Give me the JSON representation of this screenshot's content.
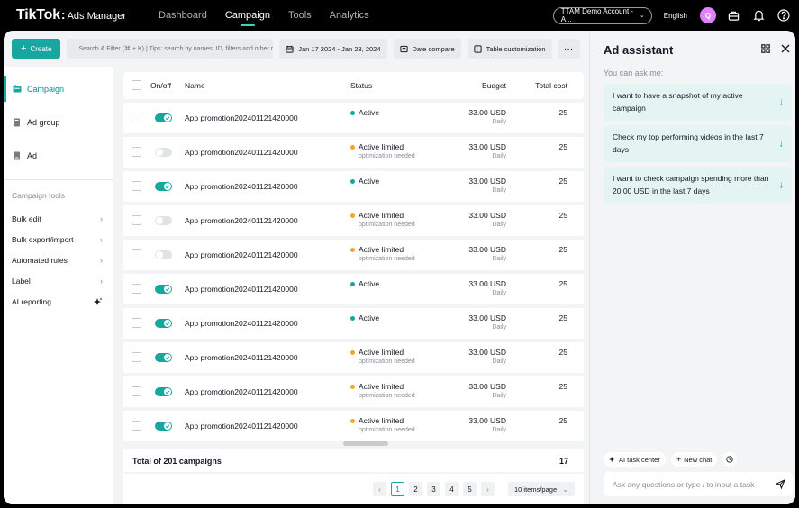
{
  "topbar": {
    "logo": "TikTok",
    "logo_sub": "Ads Manager",
    "nav": [
      "Dashboard",
      "Campaign",
      "Tools",
      "Analytics"
    ],
    "active_nav": "Campaign",
    "account": "TTAM Demo Account - A...",
    "language": "English",
    "avatar_letter": "Q"
  },
  "toolbar": {
    "create_label": "Create",
    "search_placeholder": "Search & Filter (⌘ + K)  |  Tips: search by names, ID, filters and other rela",
    "date_range": "Jan 17 2024  -  Jan 23, 2024",
    "date_compare_label": "Date compare",
    "table_custom_label": "Table customization",
    "more_label": "···"
  },
  "sidebar": {
    "levels": [
      {
        "label": "Campaign",
        "active": true
      },
      {
        "label": "Ad group",
        "active": false
      },
      {
        "label": "Ad",
        "active": false
      }
    ],
    "tools_heading": "Campaign tools",
    "tools": [
      "Bulk edit",
      "Bulk export/import",
      "Automated rules",
      "Label",
      "AI reporting"
    ]
  },
  "table": {
    "headers": {
      "onoff": "On/off",
      "name": "Name",
      "status": "Status",
      "budget": "Budget",
      "cost": "Total cost"
    },
    "rows": [
      {
        "on": true,
        "name": "App promotion202401121420000",
        "status": "Active",
        "status_sub": "",
        "budget": "33.00 USD",
        "budget_sub": "Daily",
        "cost": "25"
      },
      {
        "on": false,
        "name": "App promotion202401121420000",
        "status": "Active limited",
        "status_sub": "optimization needed",
        "budget": "33.00 USD",
        "budget_sub": "Daily",
        "cost": "25"
      },
      {
        "on": true,
        "name": "App promotion202401121420000",
        "status": "Active",
        "status_sub": "",
        "budget": "33.00 USD",
        "budget_sub": "Daily",
        "cost": "25"
      },
      {
        "on": false,
        "name": "App promotion202401121420000",
        "status": "Active limited",
        "status_sub": "optimization needed",
        "budget": "33.00 USD",
        "budget_sub": "Daily",
        "cost": "25"
      },
      {
        "on": false,
        "name": "App promotion202401121420000",
        "status": "Active limited",
        "status_sub": "optimization needed",
        "budget": "33.00 USD",
        "budget_sub": "Daily",
        "cost": "25"
      },
      {
        "on": true,
        "name": "App promotion202401121420000",
        "status": "Active",
        "status_sub": "",
        "budget": "33.00 USD",
        "budget_sub": "Daily",
        "cost": "25"
      },
      {
        "on": true,
        "name": "App promotion202401121420000",
        "status": "Active",
        "status_sub": "",
        "budget": "33.00 USD",
        "budget_sub": "Daily",
        "cost": "25"
      },
      {
        "on": true,
        "name": "App promotion202401121420000",
        "status": "Active limited",
        "status_sub": "optimization needed",
        "budget": "33.00 USD",
        "budget_sub": "Daily",
        "cost": "25"
      },
      {
        "on": true,
        "name": "App promotion202401121420000",
        "status": "Active limited",
        "status_sub": "optimization needed",
        "budget": "33.00 USD",
        "budget_sub": "Daily",
        "cost": "25"
      },
      {
        "on": true,
        "name": "App promotion202401121420000",
        "status": "Active limited",
        "status_sub": "optimization needed",
        "budget": "33.00 USD",
        "budget_sub": "Daily",
        "cost": "25"
      }
    ],
    "total_label": "Total of 201 campaigns",
    "total_cost": "17"
  },
  "pagination": {
    "prev": "‹",
    "next": "›",
    "pages": [
      "1",
      "2",
      "3",
      "4",
      "5"
    ],
    "current": "1",
    "page_size": "10 items/page"
  },
  "assistant": {
    "title": "Ad assistant",
    "subtitle": "You can ask me:",
    "suggestions": [
      "I want to have a snapshot of my active campaign",
      "Check my top performing videos in the last 7 days",
      "I want to check campaign spending more than 20.00 USD in the last 7 days"
    ],
    "task_center_label": "AI task center",
    "new_chat_label": "New chat",
    "input_placeholder": "Ask any questions or type / to input a task"
  },
  "colors": {
    "accent": "#18a79e",
    "active_dot": "#18a79e",
    "limited_dot": "#f5a623",
    "avatar": "#e081ff"
  }
}
